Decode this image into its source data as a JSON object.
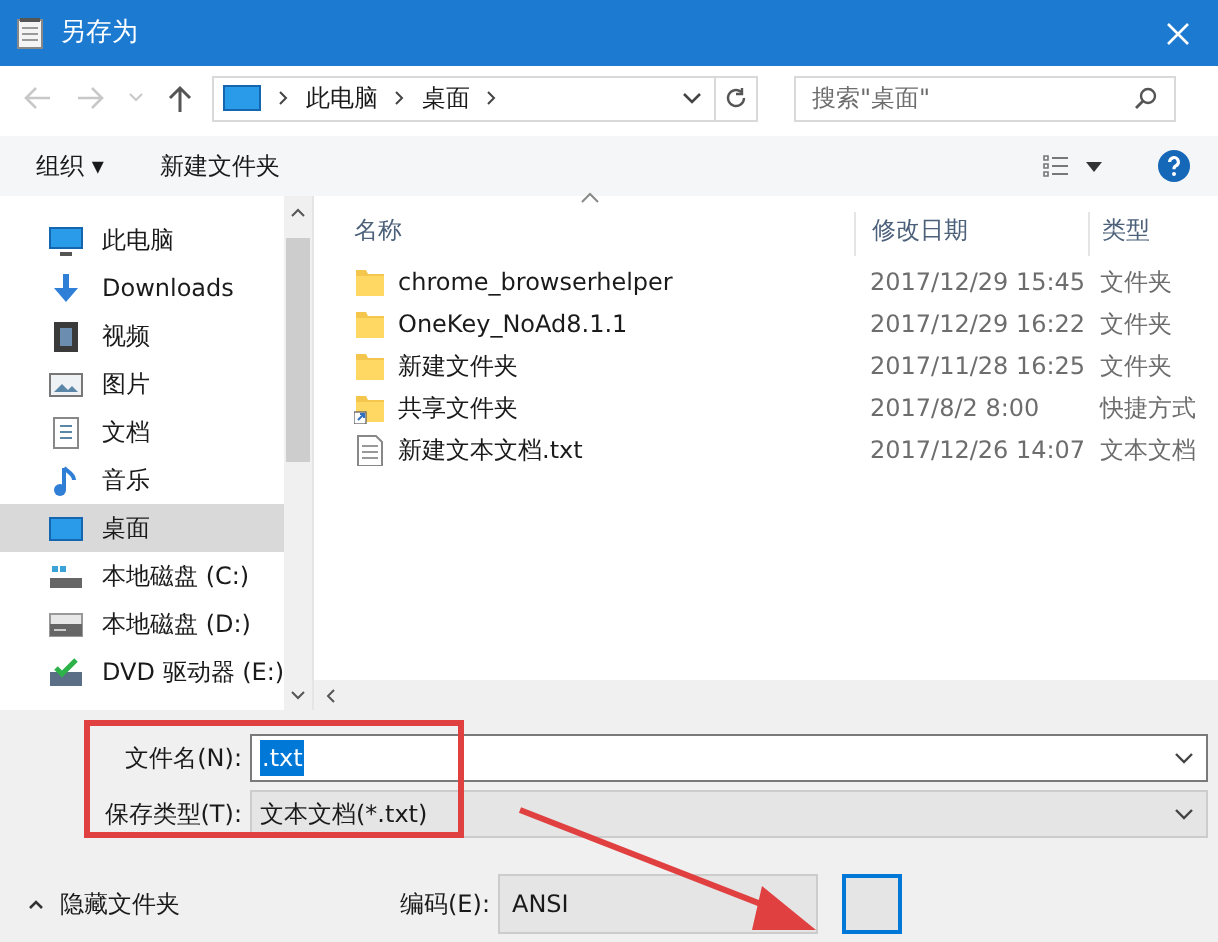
{
  "window": {
    "title": "另存为"
  },
  "address": {
    "crumbs": [
      "此电脑",
      "桌面"
    ]
  },
  "search": {
    "placeholder": "搜索\"桌面\""
  },
  "toolbar": {
    "organize": "组织 ▾",
    "new_folder": "新建文件夹"
  },
  "sidebar": {
    "items": [
      {
        "label": "此电脑",
        "kind": "pc",
        "selected": false
      },
      {
        "label": "Downloads",
        "kind": "download",
        "selected": false
      },
      {
        "label": "视频",
        "kind": "video",
        "selected": false
      },
      {
        "label": "图片",
        "kind": "picture",
        "selected": false
      },
      {
        "label": "文档",
        "kind": "doc",
        "selected": false
      },
      {
        "label": "音乐",
        "kind": "music",
        "selected": false
      },
      {
        "label": "桌面",
        "kind": "desktop",
        "selected": true
      },
      {
        "label": "本地磁盘 (C:)",
        "kind": "sysdisk",
        "selected": false
      },
      {
        "label": "本地磁盘 (D:)",
        "kind": "disk",
        "selected": false
      },
      {
        "label": "DVD 驱动器 (E:)",
        "kind": "dvd",
        "selected": false
      }
    ]
  },
  "table": {
    "columns": [
      "名称",
      "修改日期",
      "类型"
    ],
    "rows": [
      {
        "name": "chrome_browserhelper",
        "date": "2017/12/29 15:45",
        "type": "文件夹",
        "kind": "folder"
      },
      {
        "name": "OneKey_NoAd8.1.1",
        "date": "2017/12/29 16:22",
        "type": "文件夹",
        "kind": "folder"
      },
      {
        "name": "新建文件夹",
        "date": "2017/11/28 16:25",
        "type": "文件夹",
        "kind": "folder"
      },
      {
        "name": "共享文件夹",
        "date": "2017/8/2 8:00",
        "type": "快捷方式",
        "kind": "shortcut"
      },
      {
        "name": "新建文本文档.txt",
        "date": "2017/12/26 14:07",
        "type": "文本文档",
        "kind": "text"
      }
    ]
  },
  "form": {
    "filename_label": "文件名(N):",
    "filename": ".txt",
    "type_label": "保存类型(T):",
    "type": "文本文档(*.txt)",
    "encoding_label": "编码(E):",
    "encoding": "ANSI",
    "hide_folders": "隐藏文件夹"
  }
}
